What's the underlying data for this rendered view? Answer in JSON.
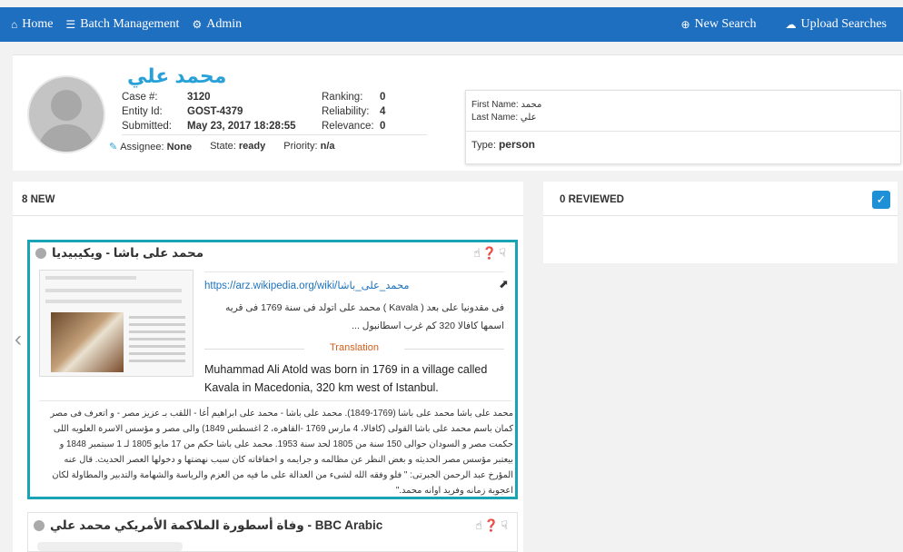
{
  "nav": {
    "home": "Home",
    "batch": "Batch Management",
    "admin": "Admin",
    "new_search": "New Search",
    "upload": "Upload Searches"
  },
  "profile": {
    "name": "محمد علي",
    "case_label": "Case #:",
    "case_value": "3120",
    "entity_label": "Entity Id:",
    "entity_value": "GOST-4379",
    "submitted_label": "Submitted:",
    "submitted_value": "May 23, 2017 18:28:55",
    "ranking_label": "Ranking:",
    "ranking_value": "0",
    "reliability_label": "Reliability:",
    "reliability_value": "4",
    "relevance_label": "Relevance:",
    "relevance_value": "0",
    "assignee_label": "Assignee:",
    "assignee_value": "None",
    "state_label": "State:",
    "state_value": "ready",
    "priority_label": "Priority:",
    "priority_value": "n/a",
    "first_name_label": "First Name:",
    "first_name_value": "محمد",
    "last_name_label": "Last Name:",
    "last_name_value": "علي",
    "type_label": "Type:",
    "type_value": "person"
  },
  "columns": {
    "new_label": "8 NEW",
    "reviewed_label": "0 REVIEWED"
  },
  "card1": {
    "title": "محمد على باشا - ويكيبيديا",
    "url": "https://arz.wikipedia.org/wiki/محمد_على_باشا",
    "arabic_snippet": "فى مقدونيا على بعد ( Kavala ) محمد على اتولد فى سنة 1769 فى قريه اسمها كافالا 320 كم غرب اسطانبول ...",
    "translation_label": "Translation",
    "english": "Muhammad Ali Atold was born in 1769 in a village called Kavala in Macedonia, 320 km west of Istanbul.",
    "arabic_body": "محمد على باشا محمد على باشا (1769-1849). محمد على باشا - محمد على ابراهيم أغا - اللقب بـ عزيز مصر - و اتعرف فى مصر كمان باسم محمد على باشا القولى (كافالا، 4 مارس 1769 -القاهره، 2 اغسطس 1849) والى مصر و مؤسس الاسرة العلويه اللى حكمت مصر و السودان حوالى 150 سنة من 1805 لحد سنة 1953. محمد على باشا حكم من 17 مايو 1805 لـ 1 سبتمبر 1848 و بيعتبر مؤسس مصر الحديثه و بغض النظر عن مظالمه و جرايمه و اخفاقاته كان سبب نهضتها و دخولها العصر الحديث. قال عنه المؤرخ عبد الرحمن الجبرتى: \" فلو وفقه الله لشىء من العدالة على ما فيه من العزم والرياسة والشهامة والتدبير والمطاولة لكان اعجوبة زمانه وفريد اوانه محمد.\""
  },
  "card2": {
    "title": "BBC Arabic - وفاة أسطورة الملاكمة الأمريكي محمد علي"
  }
}
